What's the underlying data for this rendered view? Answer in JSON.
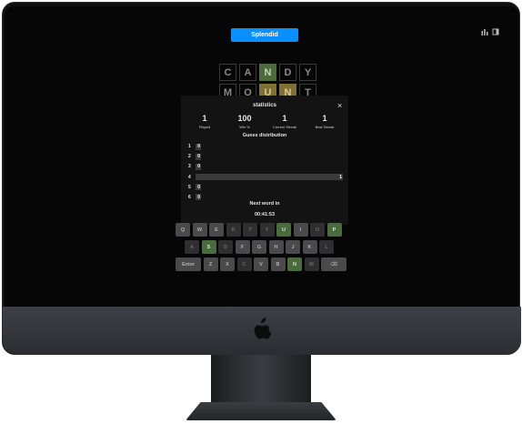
{
  "toast": {
    "message": "Splendid"
  },
  "board": {
    "rows": [
      [
        {
          "letter": "C",
          "state": "absent"
        },
        {
          "letter": "A",
          "state": "absent"
        },
        {
          "letter": "N",
          "state": "correct"
        },
        {
          "letter": "D",
          "state": "absent"
        },
        {
          "letter": "Y",
          "state": "absent"
        }
      ],
      [
        {
          "letter": "M",
          "state": "absent"
        },
        {
          "letter": "O",
          "state": "absent"
        },
        {
          "letter": "U",
          "state": "present"
        },
        {
          "letter": "N",
          "state": "present"
        },
        {
          "letter": "T",
          "state": "absent"
        }
      ]
    ]
  },
  "modal": {
    "title": "statistics",
    "close": "×",
    "stats": [
      {
        "value": "1",
        "label": "Played"
      },
      {
        "value": "100",
        "label": "Win %"
      },
      {
        "value": "1",
        "label": "Current Streak"
      },
      {
        "value": "1",
        "label": "Best Streak"
      }
    ],
    "distribution_title": "Guess distribution",
    "distribution": [
      {
        "guess": "1",
        "count": "0",
        "fraction": 0
      },
      {
        "guess": "2",
        "count": "0",
        "fraction": 0
      },
      {
        "guess": "3",
        "count": "0",
        "fraction": 0
      },
      {
        "guess": "4",
        "count": "1",
        "fraction": 1
      },
      {
        "guess": "5",
        "count": "0",
        "fraction": 0
      },
      {
        "guess": "6",
        "count": "0",
        "fraction": 0
      }
    ],
    "next_word_label": "Next word in",
    "countdown": "00:41:53"
  },
  "keyboard": {
    "rows": [
      [
        {
          "key": "Q",
          "state": "dim"
        },
        {
          "key": "W",
          "state": "dim"
        },
        {
          "key": "E",
          "state": "dim"
        },
        {
          "key": "R",
          "state": "absent"
        },
        {
          "key": "T",
          "state": "absent"
        },
        {
          "key": "Y",
          "state": "absent"
        },
        {
          "key": "U",
          "state": "correct"
        },
        {
          "key": "I",
          "state": "dim"
        },
        {
          "key": "O",
          "state": "absent"
        },
        {
          "key": "P",
          "state": "correct"
        }
      ],
      [
        {
          "key": "A",
          "state": "absent"
        },
        {
          "key": "S",
          "state": "correct"
        },
        {
          "key": "D",
          "state": "absent"
        },
        {
          "key": "F",
          "state": "dim"
        },
        {
          "key": "G",
          "state": "dim"
        },
        {
          "key": "H",
          "state": "dim"
        },
        {
          "key": "J",
          "state": "dim"
        },
        {
          "key": "K",
          "state": "dim"
        },
        {
          "key": "L",
          "state": "absent"
        }
      ],
      [
        {
          "key": "Enter",
          "state": "dim",
          "wide": true
        },
        {
          "key": "Z",
          "state": "dim"
        },
        {
          "key": "X",
          "state": "dim"
        },
        {
          "key": "C",
          "state": "absent"
        },
        {
          "key": "V",
          "state": "dim"
        },
        {
          "key": "B",
          "state": "dim"
        },
        {
          "key": "N",
          "state": "correct"
        },
        {
          "key": "M",
          "state": "absent"
        },
        {
          "key": "⌫",
          "state": "dim",
          "wide": true
        }
      ]
    ]
  }
}
